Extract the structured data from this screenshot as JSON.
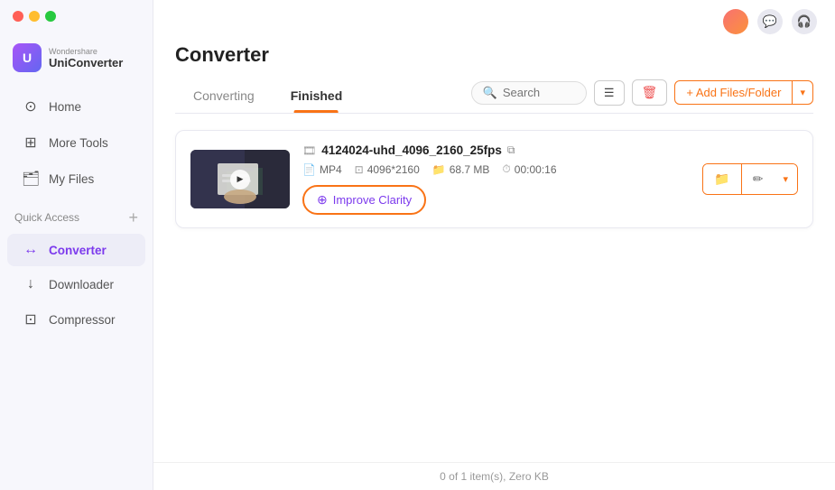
{
  "sidebar": {
    "brand": "Wondershare",
    "app_name": "UniConverter",
    "nav_items": [
      {
        "id": "home",
        "label": "Home",
        "icon": "⊙"
      },
      {
        "id": "more-tools",
        "label": "More Tools",
        "icon": "⊞"
      },
      {
        "id": "my-files",
        "label": "My Files",
        "icon": "🗂"
      }
    ],
    "quick_access_label": "Quick Access",
    "quick_access_items": [
      {
        "id": "converter",
        "label": "Converter",
        "icon": "↔"
      },
      {
        "id": "downloader",
        "label": "Downloader",
        "icon": "↓"
      },
      {
        "id": "compressor",
        "label": "Compressor",
        "icon": "⊡"
      }
    ]
  },
  "header": {
    "icons": [
      "💬",
      "🎧"
    ]
  },
  "main": {
    "title": "Converter",
    "tabs": [
      {
        "id": "converting",
        "label": "Converting"
      },
      {
        "id": "finished",
        "label": "Finished"
      }
    ],
    "active_tab": "finished",
    "search_placeholder": "Search",
    "toolbar": {
      "list_icon": "☰",
      "delete_icon": "🗑",
      "add_files_label": "+ Add Files/Folder",
      "chevron": "▾"
    },
    "file_item": {
      "name": "4124024-uhd_4096_2160_25fps",
      "format": "MP4",
      "resolution": "4096*2160",
      "size": "68.7 MB",
      "duration": "00:00:16",
      "improve_clarity_label": "Improve Clarity",
      "folder_icon": "📁",
      "edit_icon": "✏",
      "link_icon": "⧉"
    },
    "status": "0 of 1 item(s), Zero KB"
  }
}
